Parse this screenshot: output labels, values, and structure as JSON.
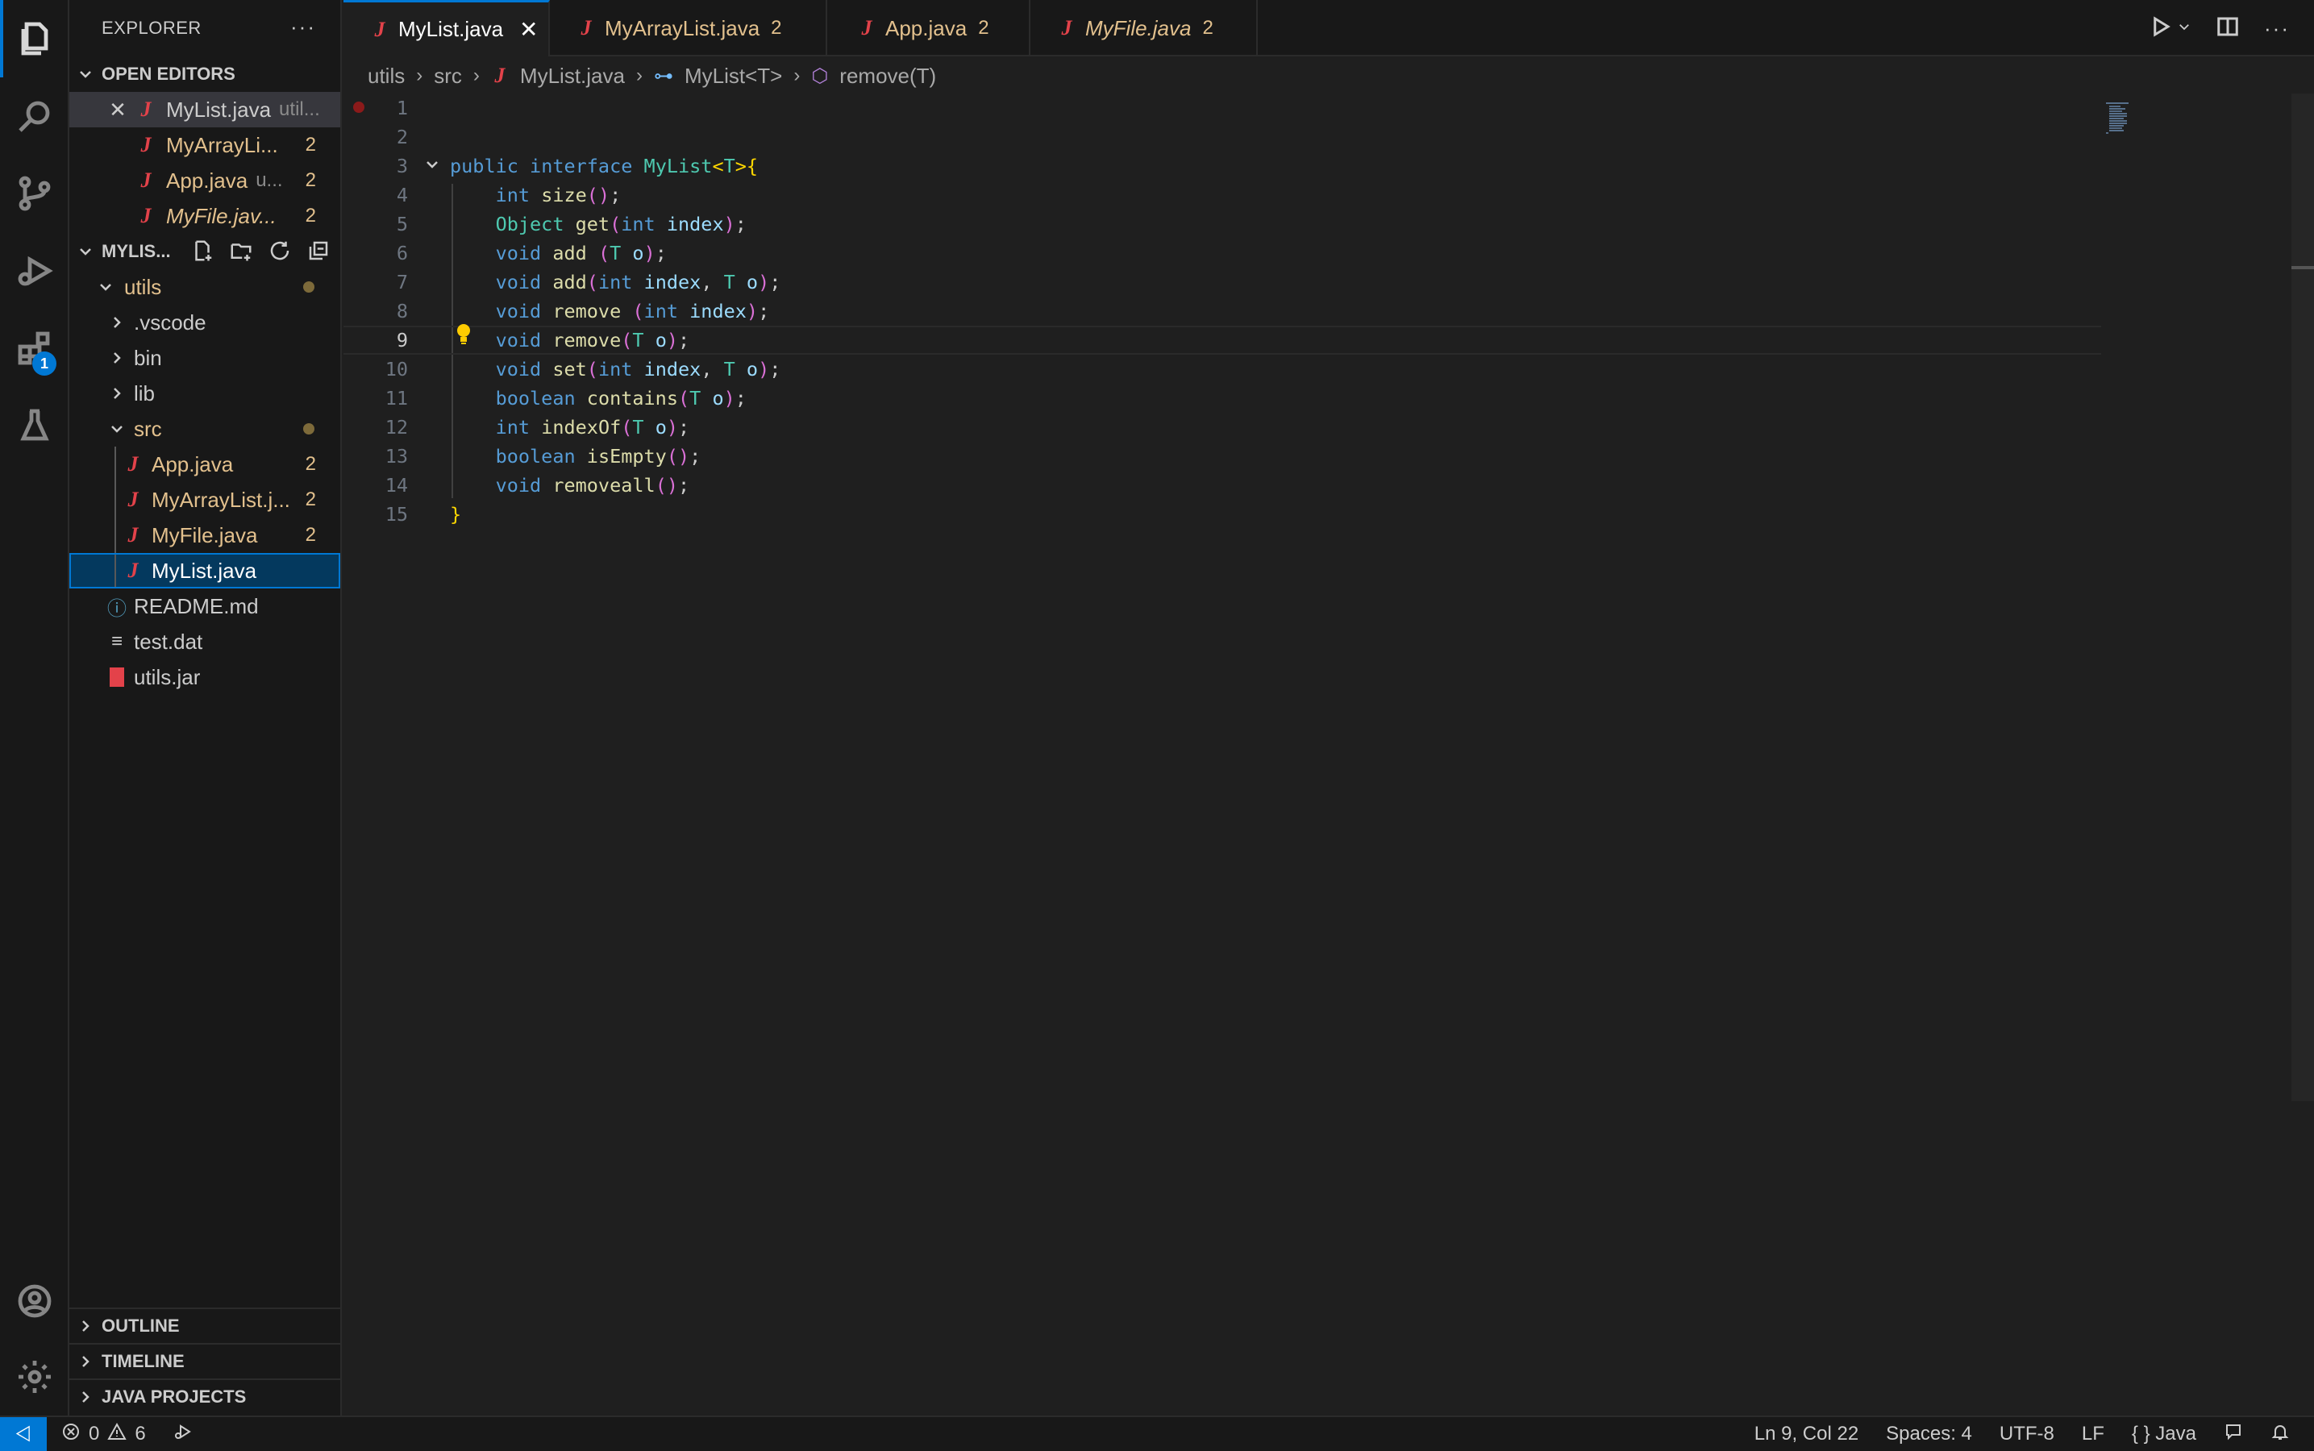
{
  "sidebar": {
    "title": "EXPLORER",
    "open_editors_label": "OPEN EDITORS",
    "open_editors": [
      {
        "name": "MyList.java",
        "desc": "util...",
        "count": ""
      },
      {
        "name": "MyArrayLi...",
        "desc": "",
        "count": "2"
      },
      {
        "name": "App.java",
        "desc": "u...",
        "count": "2"
      },
      {
        "name": "MyFile.jav...",
        "desc": "",
        "count": "2"
      }
    ],
    "project_label": "MYLIS...",
    "tree": {
      "utils": "utils",
      "vscode": ".vscode",
      "bin": "bin",
      "lib": "lib",
      "src": "src",
      "app": "App.java",
      "app_count": "2",
      "myarraylist": "MyArrayList.j...",
      "myarraylist_count": "2",
      "myfile": "MyFile.java",
      "myfile_count": "2",
      "mylist": "MyList.java",
      "readme": "README.md",
      "testdat": "test.dat",
      "utilsjar": "utils.jar"
    },
    "outline": "OUTLINE",
    "timeline": "TIMELINE",
    "java_projects": "JAVA PROJECTS",
    "extensions_badge": "1"
  },
  "tabs": [
    {
      "label": "MyList.java",
      "count": ""
    },
    {
      "label": "MyArrayList.java",
      "count": "2"
    },
    {
      "label": "App.java",
      "count": "2"
    },
    {
      "label": "MyFile.java",
      "count": "2"
    }
  ],
  "breadcrumb": {
    "folder1": "utils",
    "folder2": "src",
    "file": "MyList.java",
    "interface": "MyList<T>",
    "method": "remove(T)"
  },
  "editor": {
    "line_numbers": [
      "1",
      "2",
      "3",
      "4",
      "5",
      "6",
      "7",
      "8",
      "9",
      "10",
      "11",
      "12",
      "13",
      "14",
      "15"
    ],
    "current_line": "9"
  },
  "status": {
    "errors": "0",
    "warnings": "6",
    "position": "Ln 9, Col 22",
    "spaces": "Spaces: 4",
    "encoding": "UTF-8",
    "eol": "LF",
    "language": "Java"
  }
}
